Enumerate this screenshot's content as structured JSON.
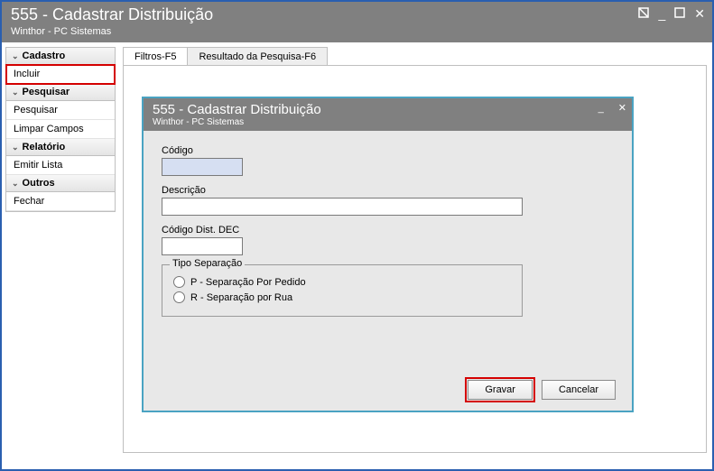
{
  "outer": {
    "title": "555 - Cadastrar Distribuição",
    "subtitle": "Winthor - PC Sistemas"
  },
  "sidebar": {
    "groups": [
      {
        "header": "Cadastro",
        "items": [
          "Incluir"
        ]
      },
      {
        "header": "Pesquisar",
        "items": [
          "Pesquisar",
          "Limpar Campos"
        ]
      },
      {
        "header": "Relatório",
        "items": [
          "Emitir Lista"
        ]
      },
      {
        "header": "Outros",
        "items": [
          "Fechar"
        ]
      }
    ]
  },
  "tabs": [
    {
      "label": "Filtros-F5",
      "active": true
    },
    {
      "label": "Resultado da Pesquisa-F6",
      "active": false
    }
  ],
  "inner": {
    "title": "555 - Cadastrar Distribuição",
    "subtitle": "Winthor - PC Sistemas",
    "fields": {
      "codigo_label": "Código",
      "codigo_value": "",
      "descricao_label": "Descrição",
      "descricao_value": "",
      "dec_label": "Código Dist. DEC",
      "dec_value": ""
    },
    "tipo_separacao": {
      "legend": "Tipo Separação",
      "options": [
        "P - Separação Por Pedido",
        "R - Separação por Rua"
      ]
    },
    "buttons": {
      "save": "Gravar",
      "cancel": "Cancelar"
    }
  }
}
